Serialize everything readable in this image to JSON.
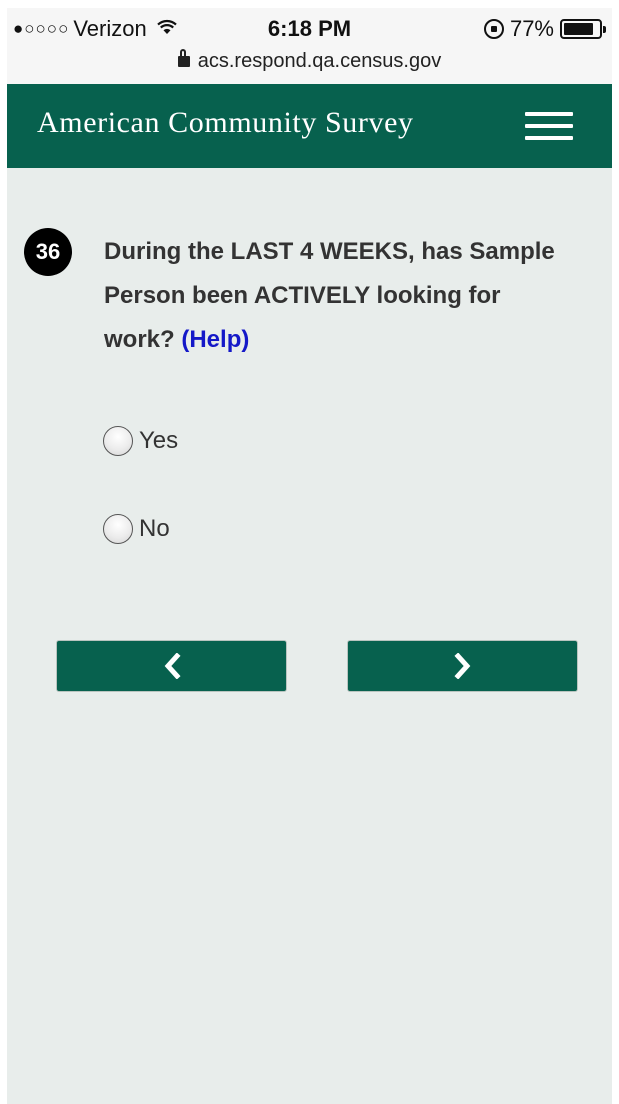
{
  "status_bar": {
    "signal": "●○○○○",
    "carrier": "Verizon",
    "time": "6:18 PM",
    "battery": "77%",
    "battery_level": 0.77,
    "url": "acs.respond.qa.census.gov"
  },
  "header": {
    "title": "American Community Survey",
    "menu_icon": "hamburger-menu-icon",
    "background": "#07614e"
  },
  "question": {
    "number": "36",
    "text": "During the LAST 4 WEEKS, has Sample Person been ACTIVELY looking for work?",
    "help_label": "(Help)"
  },
  "options": [
    {
      "label": "Yes",
      "selected": false
    },
    {
      "label": "No",
      "selected": false
    }
  ],
  "navigation": {
    "back_icon": "chevron-left-icon",
    "next_icon": "chevron-right-icon"
  }
}
